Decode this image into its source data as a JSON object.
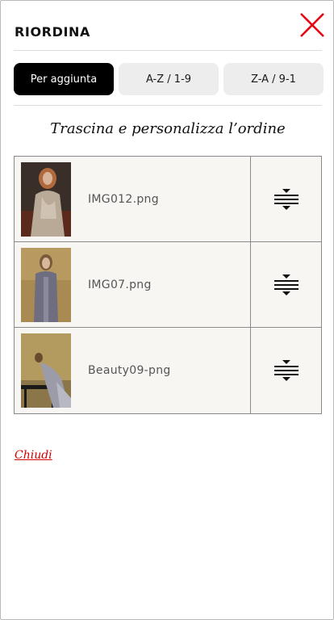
{
  "header": {
    "title": "RIORDINA",
    "close_icon": "close-icon",
    "close_color": "#e30613"
  },
  "sort": {
    "buttons": [
      {
        "label": "Per aggiunta",
        "active": true
      },
      {
        "label": "A-Z / 1-9",
        "active": false
      },
      {
        "label": "Z-A / 9-1",
        "active": false
      }
    ]
  },
  "instruction": "Trascina e personalizza l’ordine",
  "items": [
    {
      "filename": "IMG012.png",
      "handle_icon": "drag-handle-icon"
    },
    {
      "filename": "IMG07.png",
      "handle_icon": "drag-handle-icon"
    },
    {
      "filename": "Beauty09-png",
      "handle_icon": "drag-handle-icon"
    }
  ],
  "footer": {
    "close_link": "Chiudi",
    "link_color": "#d40000"
  }
}
